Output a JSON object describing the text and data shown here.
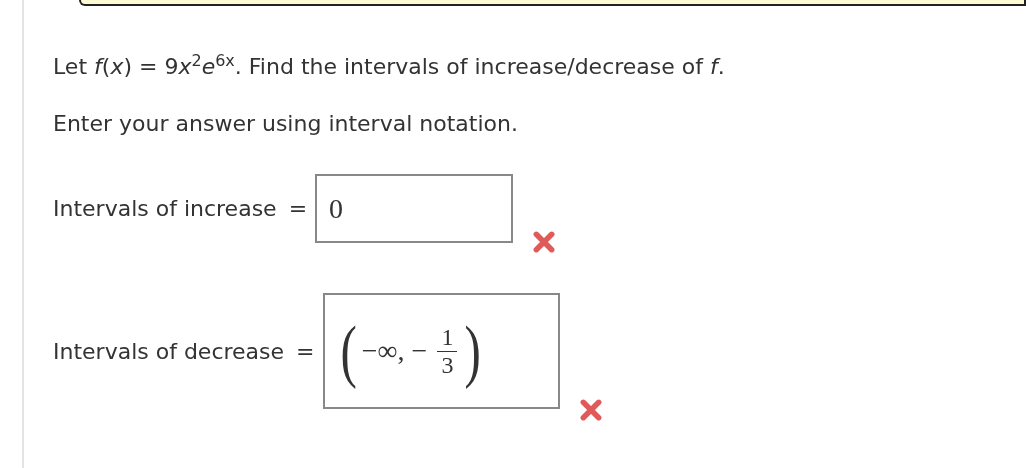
{
  "question": [
    "Let *f*(*x*) = 9",
    "*x*$^{2}$*e*$^{6x}$. Find the intervals of increase/decrease of *f*."
  ],
  "instruction": "Enter your answer using interval notation.",
  "answers": [
    {
      "label": "Intervals of increase",
      "equals": "=",
      "kind": "plain",
      "value": "0",
      "correct": false
    },
    {
      "label": "Intervals of decrease",
      "equals": "=",
      "kind": "fraction",
      "open": "(",
      "lead": "−∞, −",
      "numerator": "1",
      "denominator": "3",
      "close": ")",
      "correct": false
    }
  ]
}
